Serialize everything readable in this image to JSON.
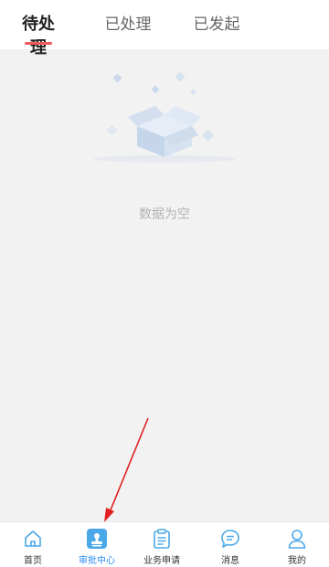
{
  "tabs": [
    {
      "label": "待处理",
      "active": true
    },
    {
      "label": "已处理",
      "active": false
    },
    {
      "label": "已发起",
      "active": false
    }
  ],
  "colors": {
    "accent": "#f05a5a",
    "nav_active": "#2a8af6",
    "icon_blue": "#4aa8e8",
    "empty_box": "#c9d8ec"
  },
  "empty_state": {
    "icon": "empty-box-icon",
    "message": "数据为空"
  },
  "bottom_nav": [
    {
      "label": "首页",
      "icon": "home-icon",
      "active": false
    },
    {
      "label": "审批中心",
      "icon": "approval-stamp-icon",
      "active": true
    },
    {
      "label": "业务申请",
      "icon": "clipboard-icon",
      "active": false
    },
    {
      "label": "消息",
      "icon": "chat-bubble-icon",
      "active": false
    },
    {
      "label": "我的",
      "icon": "person-icon",
      "active": false
    }
  ]
}
